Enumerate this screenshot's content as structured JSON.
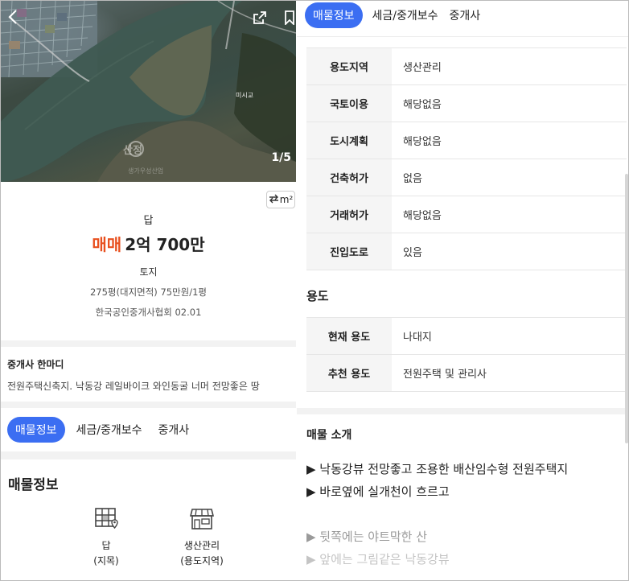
{
  "photo": {
    "counter": "1/5",
    "place_label": "미시교",
    "watermark": "산정",
    "watermark_sub": "생가우성산업",
    "icons": [
      "back-icon",
      "share-icon",
      "bookmark-icon"
    ]
  },
  "unit_toggle": {
    "label": "m²"
  },
  "summary": {
    "type": "답",
    "deal_type": "매매",
    "price": "2억 700만",
    "category": "토지",
    "area": "275평(대지면적)  75만원/1평",
    "agency": "한국공인중개사협회 02.01"
  },
  "remark": {
    "title": "중개사 한마디",
    "body": "전원주택신축지. 낙동강 레일바이크 와인동굴 너머 전망좋은 땅"
  },
  "tabs": [
    "매물정보",
    "세금/중개보수",
    "중개사"
  ],
  "info_section": {
    "title": "매물정보",
    "items": [
      {
        "value": "답",
        "label": "(지목)",
        "icon": "map-icon"
      },
      {
        "value": "생산관리",
        "label": "(용도지역)",
        "icon": "store-icon"
      }
    ]
  },
  "land_table": [
    {
      "key": "용도지역",
      "value": "생산관리"
    },
    {
      "key": "국토이용",
      "value": "해당없음"
    },
    {
      "key": "도시계획",
      "value": "해당없음"
    },
    {
      "key": "건축허가",
      "value": "없음"
    },
    {
      "key": "거래허가",
      "value": "해당없음"
    },
    {
      "key": "진입도로",
      "value": "있음"
    }
  ],
  "usage": {
    "title": "용도",
    "rows": [
      {
        "key": "현재 용도",
        "value": "나대지"
      },
      {
        "key": "추천 용도",
        "value": "전원주택 및 관리사"
      }
    ]
  },
  "intro": {
    "title": "매물 소개",
    "lines": [
      "▶ 낙동강뷰 전망좋고 조용한 배산임수형 전원주택지",
      "▶ 바로옆에 실개천이 흐르고",
      "▶ 뒷쪽에는 야트막한 산",
      "▶ 앞에는 그림같은 낙동강뷰"
    ]
  },
  "colors": {
    "accent": "#3b6ef2",
    "deal": "#e8501f"
  }
}
